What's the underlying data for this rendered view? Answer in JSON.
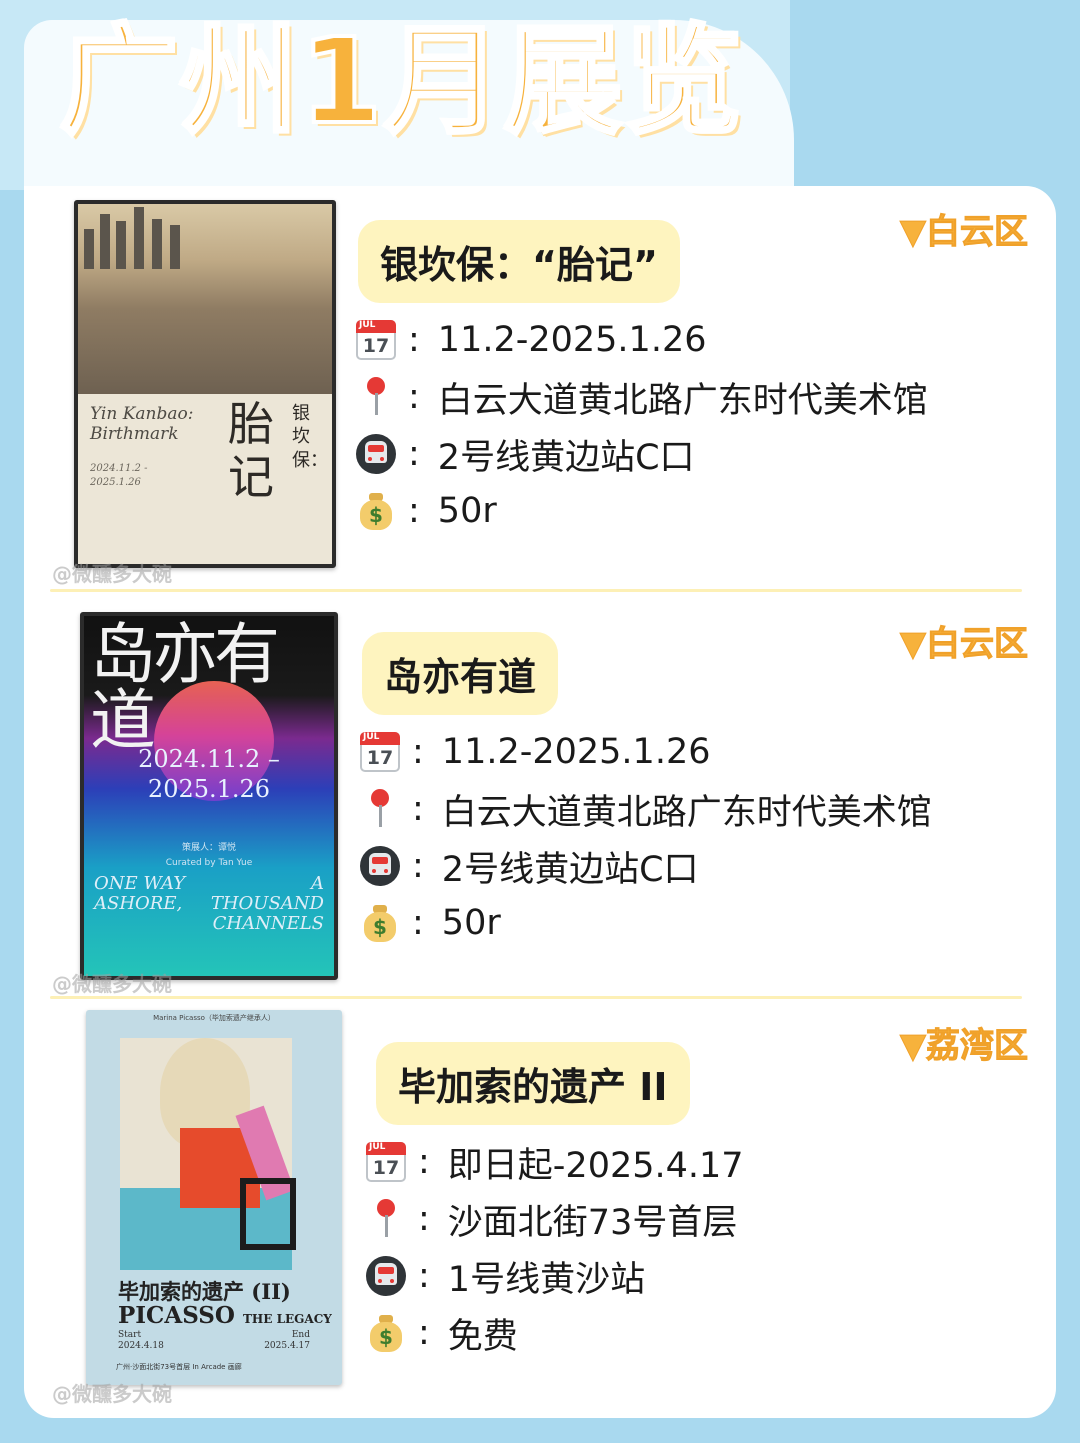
{
  "page": {
    "title": "广州1月展览",
    "watermark": "@微醺多大碗"
  },
  "exhibitions": [
    {
      "name": "银坎保：“胎记”",
      "district": "▼白云区",
      "date": "11.2-2025.1.26",
      "address": "白云大道黄北路广东时代美术馆",
      "metro": "2号线黄边站C口",
      "price": "50r",
      "poster": {
        "title_en_1": "Yin Kanbao:",
        "title_en_2": "Birthmark",
        "title_cn": "胎记",
        "artist_cn": "银坎保：",
        "dates": "2024.11.2 -",
        "dates2": "2025.1.26"
      }
    },
    {
      "name": "岛亦有道",
      "district": "▼白云区",
      "date": "11.2-2025.1.26",
      "address": "白云大道黄北路广东时代美术馆",
      "metro": "2号线黄边站C口",
      "price": "50r",
      "poster": {
        "title_cn": "岛亦有道",
        "date1": "2024.11.2 –",
        "date2": "2025.1.26",
        "curator_cn": "策展人：谭悦",
        "curator_en": "Curated by Tan Yue",
        "en_left": "ONE WAY ASHORE,",
        "en_right": "A THOUSAND CHANNELS"
      }
    },
    {
      "name": "毕加索的遗产 II",
      "district": "▼荔湾区",
      "date": "即日起-2025.4.17",
      "address": "沙面北街73号首层",
      "metro": "1号线黄沙站",
      "price": "免费",
      "poster": {
        "top": "Marina Picasso（毕加索遗产继承人）",
        "title_cn": "毕加索的遗产 (II)",
        "title_en": "PICASSO",
        "title_en_small": "THE LEGACY",
        "start_label": "Start",
        "start": "2024.4.18",
        "end_label": "End",
        "end": "2025.4.17",
        "foot": "广州·沙面北街73号首层 In Arcade 画廊"
      }
    }
  ],
  "icons": {
    "calendar": {
      "month": "JUL",
      "day": "17"
    }
  },
  "colors": {
    "background": "#a9d9ef",
    "title": "#f7b23c",
    "pill": "#fef4bf",
    "district": "#f7b23c"
  }
}
